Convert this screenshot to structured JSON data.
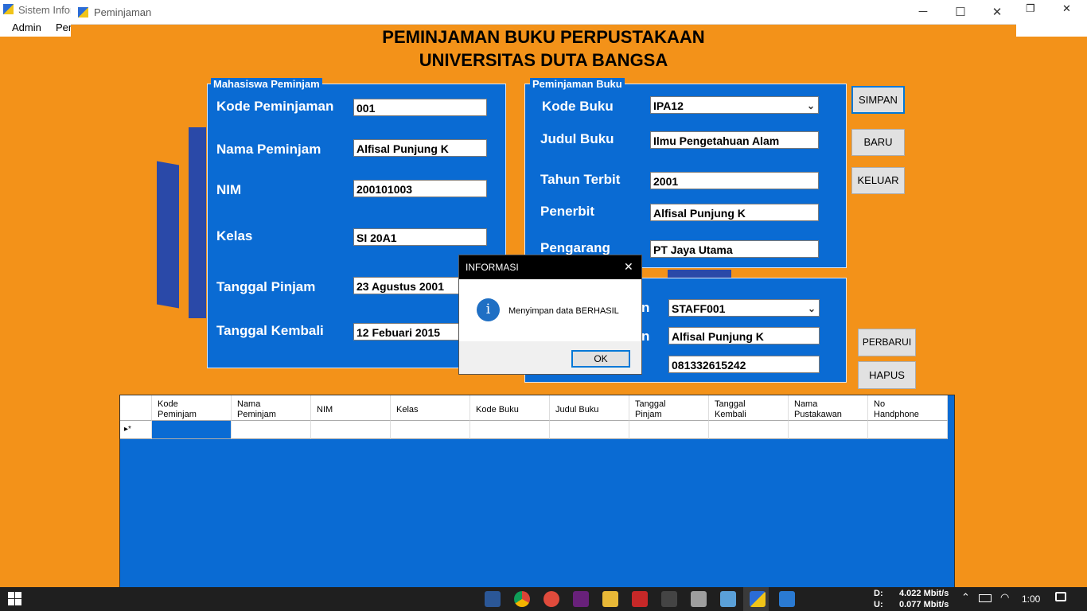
{
  "parent": {
    "title": "Sistem Infor",
    "menu": [
      "Admin",
      "Pem"
    ]
  },
  "window": {
    "title": "Peminjaman",
    "heading_line1": "PEMINJAMAN BUKU PERPUSTAKAAN",
    "heading_line2": "UNIVERSITAS DUTA BANGSA"
  },
  "mahasiswa": {
    "group_title": "Mahasiswa Peminjam",
    "kode_label": "Kode Peminjaman",
    "kode_value": "001",
    "nama_label": "Nama Peminjam",
    "nama_value": "Alfisal Punjung K",
    "nim_label": "NIM",
    "nim_value": "200101003",
    "kelas_label": "Kelas",
    "kelas_value": "SI 20A1",
    "tgl_pinjam_label": "Tanggal Pinjam",
    "tgl_pinjam_value": "23 Agustus 2001",
    "tgl_kembali_label": "Tanggal Kembali",
    "tgl_kembali_value": "12 Febuari 2015"
  },
  "buku": {
    "group_title": "Peminjaman Buku",
    "kode_label": "Kode Buku",
    "kode_value": "IPA12",
    "judul_label": "Judul Buku",
    "judul_value": "Ilmu Pengetahuan Alam",
    "tahun_label": "Tahun Terbit",
    "tahun_value": "2001",
    "penerbit_label": "Penerbit",
    "penerbit_value": "Alfisal Punjung K",
    "pengarang_label": "Pengarang",
    "pengarang_value": "PT Jaya Utama"
  },
  "pustakawan": {
    "label1_fragment": "n",
    "staff_value": "STAFF001",
    "label2_fragment": "n",
    "nama_value": "Alfisal Punjung K",
    "hp_value": "081332615242"
  },
  "buttons": {
    "simpan": "SIMPAN",
    "baru": "BARU",
    "keluar": "KELUAR",
    "perbarui": "PERBARUI",
    "hapus": "HAPUS"
  },
  "grid": {
    "row_marker": "▸*",
    "columns": [
      [
        "Kode",
        "Peminjam"
      ],
      [
        "Nama",
        "Peminjam"
      ],
      [
        "NIM",
        ""
      ],
      [
        "Kelas",
        ""
      ],
      [
        "Kode Buku",
        ""
      ],
      [
        "Judul Buku",
        ""
      ],
      [
        "Tanggal",
        "Pinjam"
      ],
      [
        "Tanggal",
        "Kembali"
      ],
      [
        "Nama",
        "Pustakawan"
      ],
      [
        "No",
        "Handphone"
      ]
    ]
  },
  "dialog": {
    "title": "INFORMASI",
    "message": "Menyimpan data BERHASIL",
    "ok": "OK"
  },
  "taskbar": {
    "down_label": "D:",
    "down_value": "4.022 Mbit/s",
    "up_label": "U:",
    "up_value": "0.077 Mbit/s",
    "clock": "1:00"
  },
  "colors": {
    "background": "#f39219",
    "panel": "#0a6bd3",
    "decor": "#2a49a8"
  }
}
